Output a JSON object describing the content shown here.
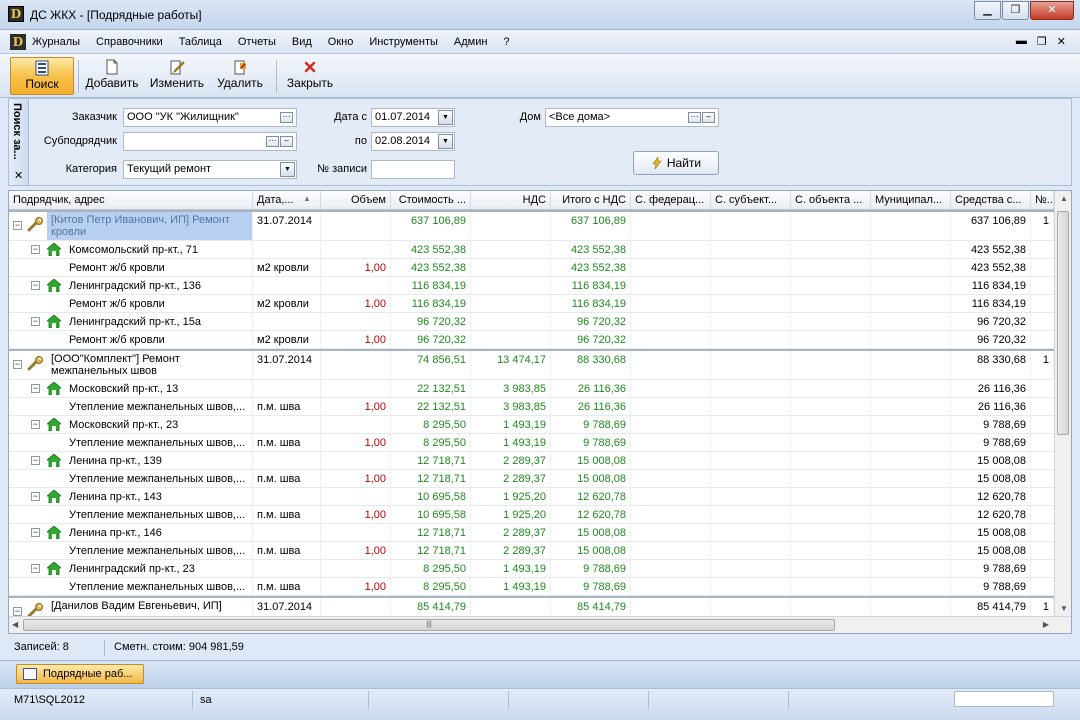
{
  "window": {
    "title": "ДС ЖКХ - [Подрядные работы]"
  },
  "menu": [
    "Журналы",
    "Справочники",
    "Таблица",
    "Отчеты",
    "Вид",
    "Окно",
    "Инструменты",
    "Админ",
    "?"
  ],
  "toolbar": {
    "search": "Поиск",
    "add": "Добавить",
    "edit": "Изменить",
    "delete": "Удалить",
    "close": "Закрыть"
  },
  "search_panel": {
    "tab_label": "Поиск за...",
    "customer_label": "Заказчик",
    "customer_value": "ООО \"УК \"Жилищник\"",
    "subcontractor_label": "Субподрядчик",
    "subcontractor_value": "",
    "category_label": "Категория",
    "category_value": "Текущий ремонт",
    "date_from_label": "Дата с",
    "date_from_value": "01.07.2014",
    "date_to_label": "по",
    "date_to_value": "02.08.2014",
    "record_no_label": "№ записи",
    "record_no_value": "",
    "house_label": "Дом",
    "house_value": "<Все дома>",
    "find_button": "Найти"
  },
  "grid": {
    "columns": [
      "Подрядчик, адрес",
      "Дата,...",
      "Объем",
      "Стоимость ...",
      "НДС",
      "Итого с НДС",
      "С. федерац...",
      "С. субъект...",
      "С. объекта ...",
      "Муниципал...",
      "Средства с...",
      "№..."
    ],
    "rows": [
      {
        "type": "group",
        "name": "[Китов Петр Иванович, ИП] Ремонт кровли",
        "date": "31.07.2014",
        "qty": "",
        "cost": "637 106,89",
        "vat": "",
        "total": "637 106,89",
        "funds": "637 106,89",
        "no": "1",
        "selected": true
      },
      {
        "type": "address",
        "name": "Комсомольский пр-кт., 71",
        "unit": "",
        "qty": "",
        "cost": "423 552,38",
        "vat": "",
        "total": "423 552,38",
        "funds": "423 552,38"
      },
      {
        "type": "work",
        "name": "Ремонт ж/б кровли",
        "unit": "м2 кровли",
        "qty": "1,00",
        "cost": "423 552,38",
        "vat": "",
        "total": "423 552,38",
        "funds": "423 552,38"
      },
      {
        "type": "address",
        "name": "Ленинградский пр-кт., 136",
        "unit": "",
        "qty": "",
        "cost": "116 834,19",
        "vat": "",
        "total": "116 834,19",
        "funds": "116 834,19"
      },
      {
        "type": "work",
        "name": "Ремонт ж/б кровли",
        "unit": "м2 кровли",
        "qty": "1,00",
        "cost": "116 834,19",
        "vat": "",
        "total": "116 834,19",
        "funds": "116 834,19"
      },
      {
        "type": "address",
        "name": "Ленинградский пр-кт., 15а",
        "unit": "",
        "qty": "",
        "cost": "96 720,32",
        "vat": "",
        "total": "96 720,32",
        "funds": "96 720,32"
      },
      {
        "type": "work",
        "name": "Ремонт ж/б кровли",
        "unit": "м2 кровли",
        "qty": "1,00",
        "cost": "96 720,32",
        "vat": "",
        "total": "96 720,32",
        "funds": "96 720,32"
      },
      {
        "type": "group",
        "name": "[ООО\"Комплект\"] Ремонт межпанельных швов",
        "date": "31.07.2014",
        "qty": "",
        "cost": "74 856,51",
        "vat": "13 474,17",
        "total": "88 330,68",
        "funds": "88 330,68",
        "no": "1"
      },
      {
        "type": "address",
        "name": "Московский пр-кт., 13",
        "unit": "",
        "qty": "",
        "cost": "22 132,51",
        "vat": "3 983,85",
        "total": "26 116,36",
        "funds": "26 116,36"
      },
      {
        "type": "work",
        "name": "Утепление межпанельных швов,...",
        "unit": "п.м. шва",
        "qty": "1,00",
        "cost": "22 132,51",
        "vat": "3 983,85",
        "total": "26 116,36",
        "funds": "26 116,36"
      },
      {
        "type": "address",
        "name": "Московский пр-кт., 23",
        "unit": "",
        "qty": "",
        "cost": "8 295,50",
        "vat": "1 493,19",
        "total": "9 788,69",
        "funds": "9 788,69"
      },
      {
        "type": "work",
        "name": "Утепление межпанельных швов,...",
        "unit": "п.м. шва",
        "qty": "1,00",
        "cost": "8 295,50",
        "vat": "1 493,19",
        "total": "9 788,69",
        "funds": "9 788,69"
      },
      {
        "type": "address",
        "name": "Ленина пр-кт., 139",
        "unit": "",
        "qty": "",
        "cost": "12 718,71",
        "vat": "2 289,37",
        "total": "15 008,08",
        "funds": "15 008,08"
      },
      {
        "type": "work",
        "name": "Утепление межпанельных швов,...",
        "unit": "п.м. шва",
        "qty": "1,00",
        "cost": "12 718,71",
        "vat": "2 289,37",
        "total": "15 008,08",
        "funds": "15 008,08"
      },
      {
        "type": "address",
        "name": "Ленина пр-кт., 143",
        "unit": "",
        "qty": "",
        "cost": "10 695,58",
        "vat": "1 925,20",
        "total": "12 620,78",
        "funds": "12 620,78"
      },
      {
        "type": "work",
        "name": "Утепление межпанельных швов,...",
        "unit": "п.м. шва",
        "qty": "1,00",
        "cost": "10 695,58",
        "vat": "1 925,20",
        "total": "12 620,78",
        "funds": "12 620,78"
      },
      {
        "type": "address",
        "name": "Ленина пр-кт., 146",
        "unit": "",
        "qty": "",
        "cost": "12 718,71",
        "vat": "2 289,37",
        "total": "15 008,08",
        "funds": "15 008,08"
      },
      {
        "type": "work",
        "name": "Утепление межпанельных швов,...",
        "unit": "п.м. шва",
        "qty": "1,00",
        "cost": "12 718,71",
        "vat": "2 289,37",
        "total": "15 008,08",
        "funds": "15 008,08"
      },
      {
        "type": "address",
        "name": "Ленинградский пр-кт., 23",
        "unit": "",
        "qty": "",
        "cost": "8 295,50",
        "vat": "1 493,19",
        "total": "9 788,69",
        "funds": "9 788,69"
      },
      {
        "type": "work",
        "name": "Утепление межпанельных швов,...",
        "unit": "п.м. шва",
        "qty": "1,00",
        "cost": "8 295,50",
        "vat": "1 493,19",
        "total": "9 788,69",
        "funds": "9 788,69"
      },
      {
        "type": "group",
        "name": "[Данилов Вадим Евгеньевич, ИП]",
        "date": "31.07.2014",
        "qty": "",
        "cost": "85 414,79",
        "vat": "",
        "total": "85 414,79",
        "funds": "85 414,79",
        "no": "1"
      }
    ]
  },
  "summary": {
    "records": "Записей: 8",
    "estimate": "Сметн. стоим: 904 981,59"
  },
  "taskbar": {
    "task_label": "Подрядные раб..."
  },
  "status": {
    "server": "M71\\SQL2012",
    "user": "sa"
  },
  "colors": {
    "accent": "#f5b02f",
    "value_green": "#1f8a1f",
    "value_red": "#c00000",
    "selection": "#b7cff0"
  }
}
